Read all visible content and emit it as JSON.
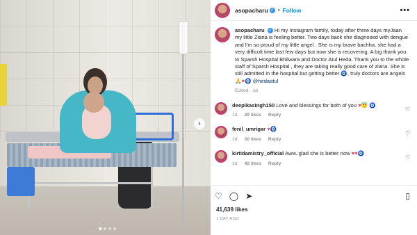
{
  "post_header": {
    "username": "asopacharu",
    "follow_label": "Follow",
    "separator": "•",
    "more_label": "•••"
  },
  "media": {
    "next_arrow": "›",
    "carousel_dots": 4,
    "active_dot": 0
  },
  "caption": {
    "username": "asopacharu",
    "text": "Hi my Instagram family, today after three days myJaan my little Ziana is feeling better. Two days back she diagnosed with dengue and I'm so proud of my little angel . She is my brave bachha. she had a very difficult time last few days but now she is recovering. A big thank you to Sparsh Hospital Bhilwara and Doctor Atul Heda. Thank you to the whole staff of Sparsh Hospital , they are taking really good care of ziana. She is still admitted in the hospital but getting better",
    "text_tail": ", truly doctors are angels",
    "emojis": "🙏♥🧿",
    "mention": "@hedaatul",
    "edited": "Edited",
    "time": "1d"
  },
  "comments": [
    {
      "username": "deepikasingh150",
      "text": "Love and blessings for both of you",
      "emojis": "♥😇 🧿",
      "time": "1d",
      "likes": "29 likes",
      "reply": "Reply"
    },
    {
      "username": "fenil_umrigar",
      "text": "",
      "emojis": "♥🧿",
      "time": "1d",
      "likes": "30 likes",
      "reply": "Reply"
    },
    {
      "username": "kirtidamistry_official",
      "text": "Aww..glad she is better now",
      "emojis": "♥♥🧿",
      "time": "1d",
      "likes": "42 likes",
      "reply": "Reply"
    }
  ],
  "actions": {
    "like_icon": "♡",
    "comment_icon": "◯",
    "share_icon": "➤",
    "save_icon": "▯"
  },
  "stats": {
    "likes": "41,639 likes",
    "posted": "1 DAY AGO"
  }
}
